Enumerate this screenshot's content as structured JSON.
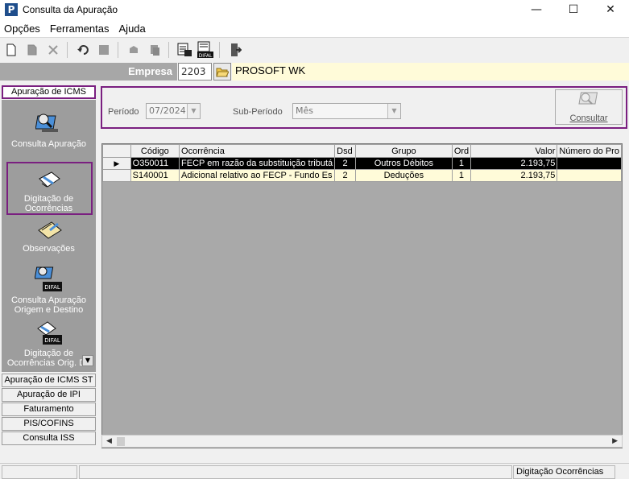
{
  "window": {
    "title": "Consulta da Apuração",
    "app_icon_letter": "P",
    "minimize": "—",
    "maximize": "☐",
    "close": "✕"
  },
  "menu": [
    "Opções",
    "Ferramentas",
    "Ajuda"
  ],
  "toolbar": {
    "icons": [
      "new-doc-icon",
      "edit-icon",
      "delete-icon",
      "undo-icon",
      "save-icon",
      "print-icon",
      "copy-icon",
      "report-icon",
      "difal-icon",
      "exit-icon"
    ],
    "difal_label": "DIFAL"
  },
  "company": {
    "label": "Empresa",
    "code": "2203",
    "name": "PROSOFT WK"
  },
  "leftbar": {
    "active_group": "Apuração de ICMS",
    "items": [
      {
        "label": "Consulta Apuração"
      },
      {
        "label": "Digitação de Ocorrências"
      },
      {
        "label": "Observações"
      },
      {
        "label": "Consulta Apuração Origem e Destino"
      },
      {
        "label": "Digitação de Ocorrências Orig. De"
      }
    ],
    "groups": [
      "Apuração de ICMS ST",
      "Apuração de IPI",
      "Faturamento",
      "PIS/COFINS",
      "Consulta ISS"
    ],
    "icon_badge": "DIFAL"
  },
  "filter": {
    "periodo_label": "Período",
    "periodo_value": "07/2024",
    "subperiodo_label": "Sub-Período",
    "subperiodo_value": "Mês",
    "consultar_label": "Consultar"
  },
  "grid": {
    "columns": [
      "Código",
      "Ocorrência",
      "Dsd",
      "Grupo",
      "Ord",
      "Valor",
      "Número do Pro"
    ],
    "rows": [
      {
        "codigo": "O350011",
        "ocorrencia": "FECP em razão da substituição tributá",
        "dsd": "2",
        "grupo": "Outros Débitos",
        "ord": "1",
        "valor": "2.193,75",
        "numero": ""
      },
      {
        "codigo": "S140001",
        "ocorrencia": "Adicional relativo ao FECP - Fundo Es",
        "dsd": "2",
        "grupo": "Deduções",
        "ord": "1",
        "valor": "2.193,75",
        "numero": ""
      }
    ],
    "current_marker": "▶"
  },
  "statusbar": {
    "right_text": "Digitação Ocorrências"
  },
  "colors": {
    "highlight": "#7a1f80",
    "row_yellow": "#fffbd9",
    "panel_gray": "#9d9d9d"
  }
}
